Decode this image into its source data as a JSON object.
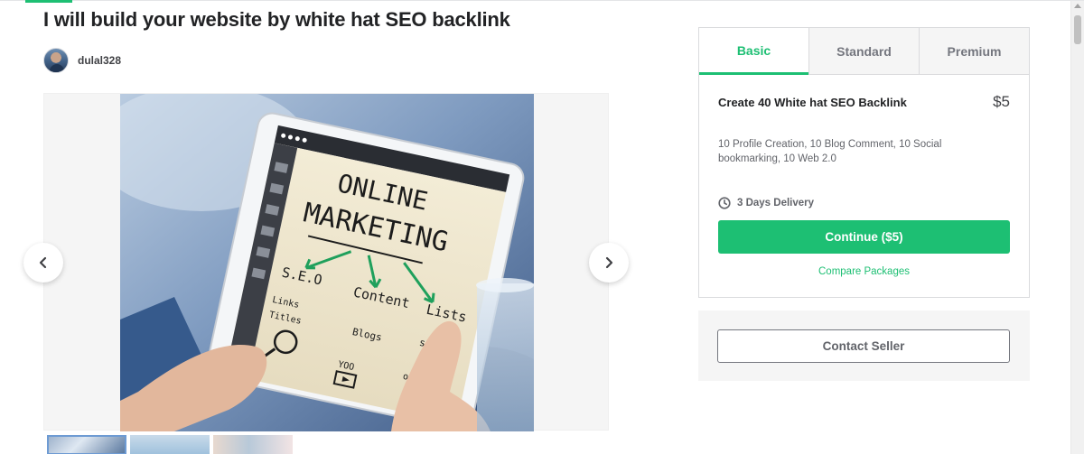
{
  "gig": {
    "title": "I will build your website by white hat SEO backlink",
    "seller_name": "dulal328"
  },
  "gallery": {
    "prev_icon": "chevron-left-icon",
    "next_icon": "chevron-right-icon",
    "slide_text": {
      "line1": "ONLINE",
      "line2": "MARKETING",
      "seo": "S.E.O",
      "content": "Content",
      "lists": "Lists",
      "links": "Links",
      "titles": "Titles",
      "blogs": "Blogs",
      "sales": "sales",
      "yoo": "YOO",
      "opt": "opt-Ins"
    }
  },
  "packages": {
    "tabs": [
      {
        "label": "Basic",
        "active": true
      },
      {
        "label": "Standard",
        "active": false
      },
      {
        "label": "Premium",
        "active": false
      }
    ],
    "selected": {
      "title": "Create 40 White hat SEO Backlink",
      "price": "$5",
      "description": "10 Profile Creation, 10 Blog Comment, 10 Social bookmarking, 10 Web 2.0",
      "delivery": "3 Days Delivery",
      "continue_label": "Continue ($5)",
      "compare_label": "Compare Packages"
    }
  },
  "contact": {
    "button_label": "Contact Seller"
  },
  "colors": {
    "accent": "#1dbf73",
    "text": "#222325",
    "muted": "#62646a"
  }
}
